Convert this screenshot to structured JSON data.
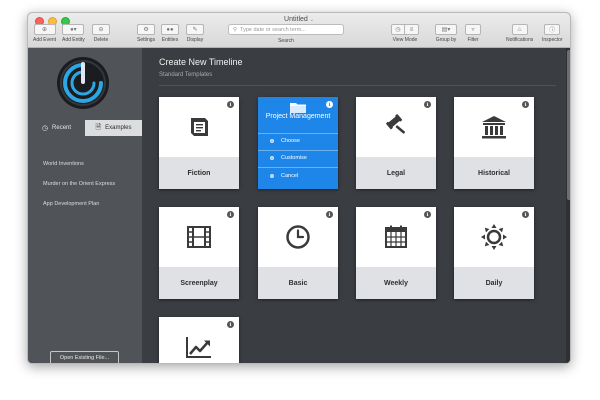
{
  "window": {
    "title": "Untitled"
  },
  "toolbar": {
    "add_event": "Add Event",
    "add_entity": "Add Entity",
    "delete": "Delete",
    "settings": "Settings",
    "entities": "Entities",
    "display": "Display",
    "search_placeholder": "Type date or search term...",
    "search_label": "Search",
    "view_mode": "View Mode",
    "group_by": "Group by",
    "filter": "Filter",
    "notifications": "Notifications",
    "inspector": "Inspector"
  },
  "sidebar": {
    "tabs": [
      {
        "label": "Recent",
        "icon": "clock-icon"
      },
      {
        "label": "Examples",
        "icon": "document-icon"
      }
    ],
    "items": [
      {
        "label": "World Inventions"
      },
      {
        "label": "Murder on the Orient Express"
      },
      {
        "label": "App Development Plan"
      }
    ],
    "open_button": "Open Existing File..."
  },
  "main": {
    "heading": "Create New Timeline",
    "subheading": "Standard Templates",
    "info_glyph": "i",
    "templates": [
      {
        "label": "Fiction",
        "icon": "book-icon"
      },
      {
        "label": "Project Management",
        "icon": "folder-icon",
        "selected": true
      },
      {
        "label": "Legal",
        "icon": "gavel-icon"
      },
      {
        "label": "Historical",
        "icon": "building-icon"
      },
      {
        "label": "Screenplay",
        "icon": "film-icon"
      },
      {
        "label": "Basic",
        "icon": "clock-icon"
      },
      {
        "label": "Weekly",
        "icon": "calendar-icon"
      },
      {
        "label": "Daily",
        "icon": "sun-icon"
      },
      {
        "label": "",
        "icon": "trend-chart-icon"
      }
    ],
    "selected_options": [
      "Choose",
      "Customise",
      "Cancel"
    ]
  },
  "colors": {
    "accent": "#1d86e8",
    "sidebar_bg": "#505358",
    "main_bg": "#3a3d42",
    "card_footer": "#dfe1e4"
  }
}
